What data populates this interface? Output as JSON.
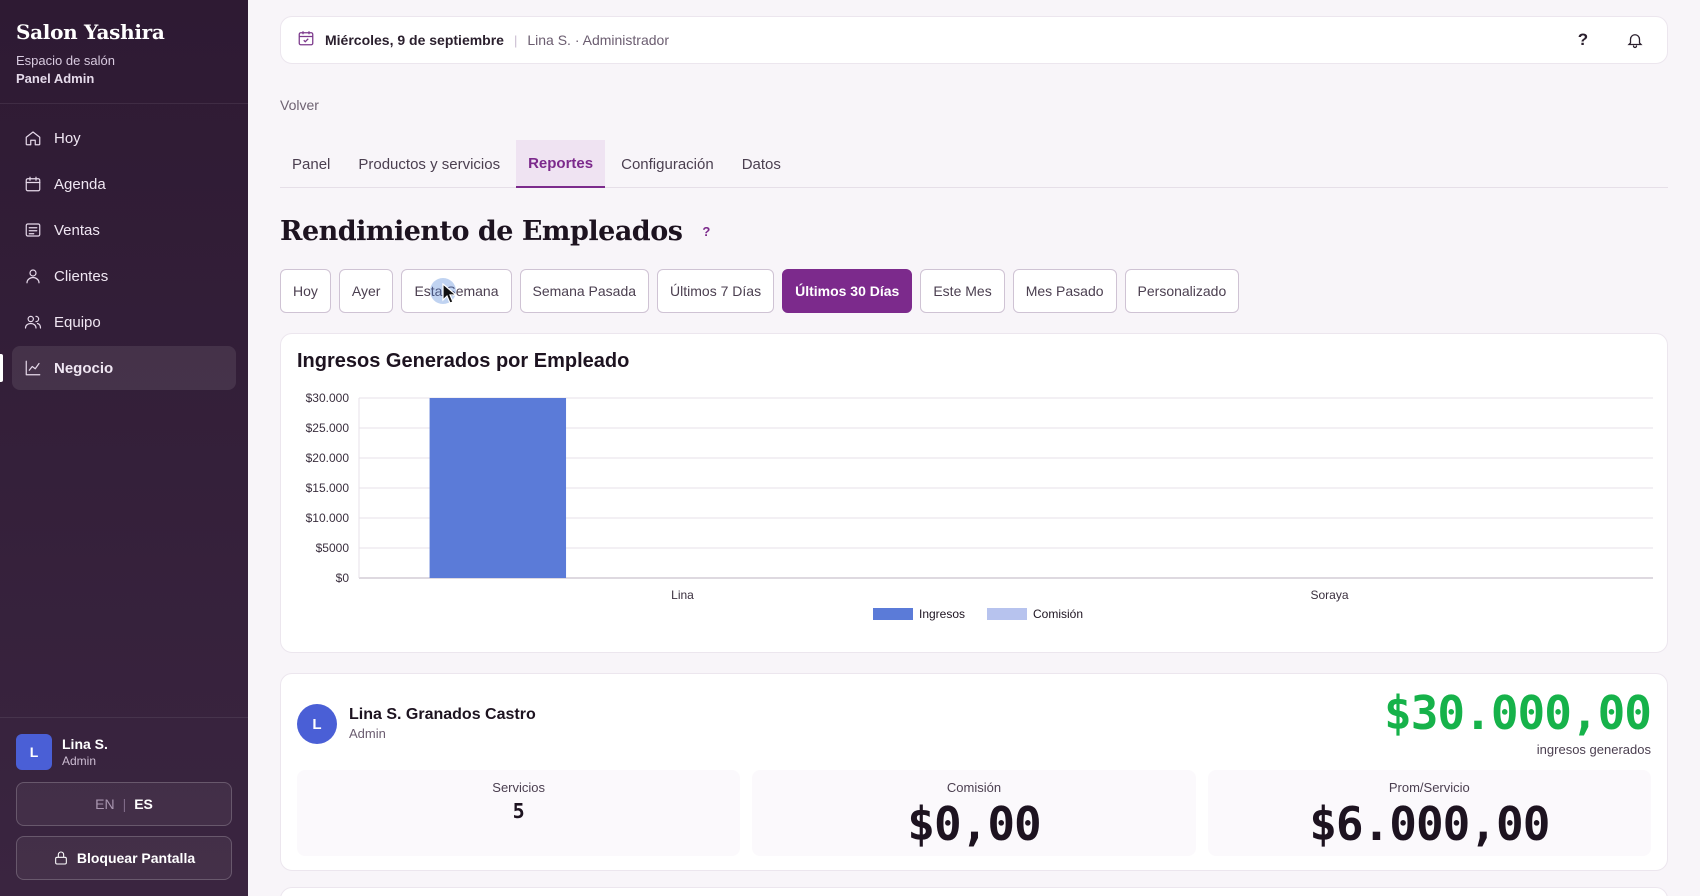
{
  "sidebar": {
    "brand": "Salon Yashira",
    "subtitle": "Espacio de salón",
    "panel": "Panel Admin",
    "items": [
      {
        "label": "Hoy",
        "icon": "home-icon"
      },
      {
        "label": "Agenda",
        "icon": "calendar-icon"
      },
      {
        "label": "Ventas",
        "icon": "receipt-icon"
      },
      {
        "label": "Clientes",
        "icon": "user-icon"
      },
      {
        "label": "Equipo",
        "icon": "team-icon"
      },
      {
        "label": "Negocio",
        "icon": "chart-line-icon",
        "active": true
      }
    ],
    "user": {
      "initial": "L",
      "name": "Lina S.",
      "role": "Admin"
    },
    "languages": {
      "en": "EN",
      "sep": "|",
      "es": "ES",
      "selected": "ES"
    },
    "lock_label": "Bloquear Pantalla"
  },
  "topbar": {
    "date": "Miércoles, 9 de septiembre",
    "separator": "|",
    "user": "Lina S. · Administrador",
    "help": "?"
  },
  "back_label": "Volver",
  "tabs": [
    {
      "label": "Panel"
    },
    {
      "label": "Productos y servicios"
    },
    {
      "label": "Reportes",
      "active": true
    },
    {
      "label": "Configuración"
    },
    {
      "label": "Datos"
    }
  ],
  "page_title": "Rendimiento de Empleados",
  "title_help": "?",
  "ranges": [
    {
      "label": "Hoy"
    },
    {
      "label": "Ayer"
    },
    {
      "label": "Esta Semana"
    },
    {
      "label": "Semana Pasada"
    },
    {
      "label": "Últimos 7 Días"
    },
    {
      "label": "Últimos 30 Días",
      "active": true
    },
    {
      "label": "Este Mes"
    },
    {
      "label": "Mes Pasado"
    },
    {
      "label": "Personalizado"
    }
  ],
  "chart_data": {
    "type": "bar",
    "title": "Ingresos Generados por Empleado",
    "categories": [
      "Lina",
      "Soraya"
    ],
    "series": [
      {
        "name": "Ingresos",
        "values": [
          30000,
          0
        ],
        "color": "#5b7bd8"
      },
      {
        "name": "Comisión",
        "values": [
          0,
          0
        ],
        "color": "#b7c3ee"
      }
    ],
    "yticks": [
      "$0",
      "$5000",
      "$10.000",
      "$15.000",
      "$20.000",
      "$25.000",
      "$30.000"
    ],
    "ylim": [
      0,
      30000
    ],
    "grid": true,
    "legend": "bottom"
  },
  "employee": {
    "initial": "L",
    "name": "Lina S. Granados Castro",
    "role": "Admin",
    "revenue": "$30.000,00",
    "revenue_label": "ingresos generados",
    "stats": {
      "services_label": "Servicios",
      "services": "5",
      "commission_label": "Comisión",
      "commission": "$0,00",
      "avg_label": "Prom/Servicio",
      "avg": "$6.000,00"
    }
  },
  "colors": {
    "accent": "#7c2a8c",
    "sidebar": "#2e1a33",
    "revenue_green": "#16b24a",
    "bar_blue": "#5b7bd8"
  }
}
